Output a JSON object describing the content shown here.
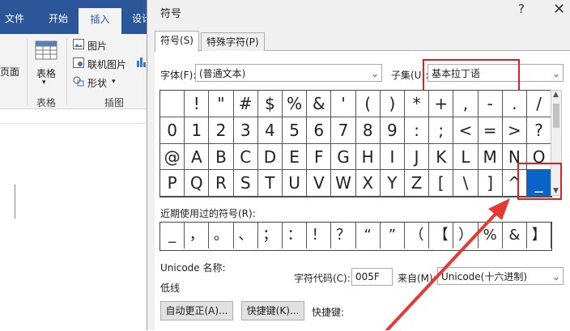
{
  "word": {
    "tabs": [
      "文件",
      "开始",
      "插入",
      "设计"
    ],
    "active_tab": "插入",
    "ribbon": {
      "page_label": "页面",
      "table_label": "表格",
      "table_group": "表格",
      "picture_label": "图片",
      "online_picture_label": "联机图片",
      "shapes_label": "形状",
      "illustrations_group": "插图"
    }
  },
  "dialog": {
    "title": "符号",
    "help": "?",
    "close": "✕",
    "tabs": [
      "符号(S)",
      "特殊字符(P)"
    ],
    "font_label": "字体(F):",
    "font_value": "(普通文本)",
    "subset_label": "子集(U):",
    "subset_value": "基本拉丁语",
    "symbols": [
      " ",
      "!",
      "\"",
      "#",
      "$",
      "%",
      "&",
      "'",
      "(",
      ")",
      "*",
      "+",
      ",",
      "-",
      ".",
      "/",
      "0",
      "1",
      "2",
      "3",
      "4",
      "5",
      "6",
      "7",
      "8",
      "9",
      ":",
      ";",
      "<",
      "=",
      ">",
      "?",
      "@",
      "A",
      "B",
      "C",
      "D",
      "E",
      "F",
      "G",
      "H",
      "I",
      "J",
      "K",
      "L",
      "M",
      "N",
      "O",
      "P",
      "Q",
      "R",
      "S",
      "T",
      "U",
      "V",
      "W",
      "X",
      "Y",
      "Z",
      "[",
      "\\",
      "]",
      "^",
      "_"
    ],
    "selected_symbol": "_",
    "recent_label": "近期使用过的符号(R):",
    "recent_symbols": [
      "_",
      "，",
      "。",
      "、",
      "；",
      "：",
      "！",
      "？",
      "“",
      "”",
      "（",
      "【",
      "）",
      "%",
      "&",
      "】"
    ],
    "unicode_name_label": "Unicode 名称:",
    "unicode_name_value": "低线",
    "char_code_label": "字符代码(C):",
    "char_code_value": "005F",
    "from_label": "来自(M):",
    "from_value": "Unicode(十六进制)",
    "autocorrect_button": "自动更正(A)...",
    "shortcut_button": "快捷键(K)...",
    "shortcut_label": "快捷键:"
  },
  "colors": {
    "word_blue": "#2b579a",
    "selection_blue": "#0a64c8",
    "annotation_red": "#e02020"
  }
}
